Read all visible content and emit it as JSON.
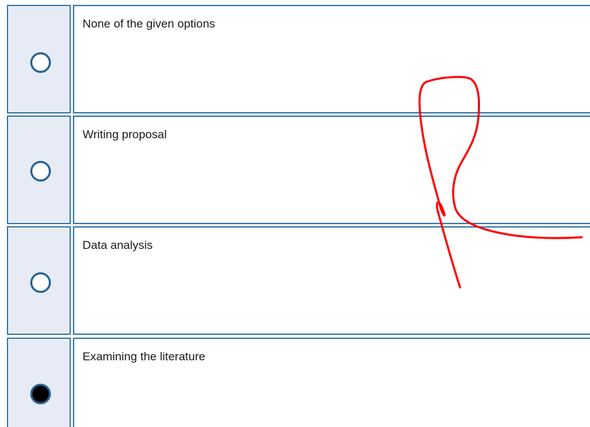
{
  "options": [
    {
      "label": "None of the given options",
      "checked": false
    },
    {
      "label": "Writing proposal",
      "checked": false
    },
    {
      "label": "Data analysis",
      "checked": false
    },
    {
      "label": "Examining the literature",
      "checked": true
    }
  ],
  "colors": {
    "cell_border": "#3e7bb0",
    "radio_cell_bg": "#e6ebf6",
    "radio_ring": "#2a6291",
    "annotation_stroke": "#ff0000"
  },
  "annotation": {
    "type": "handwritten-mark",
    "color": "#ff0000"
  }
}
